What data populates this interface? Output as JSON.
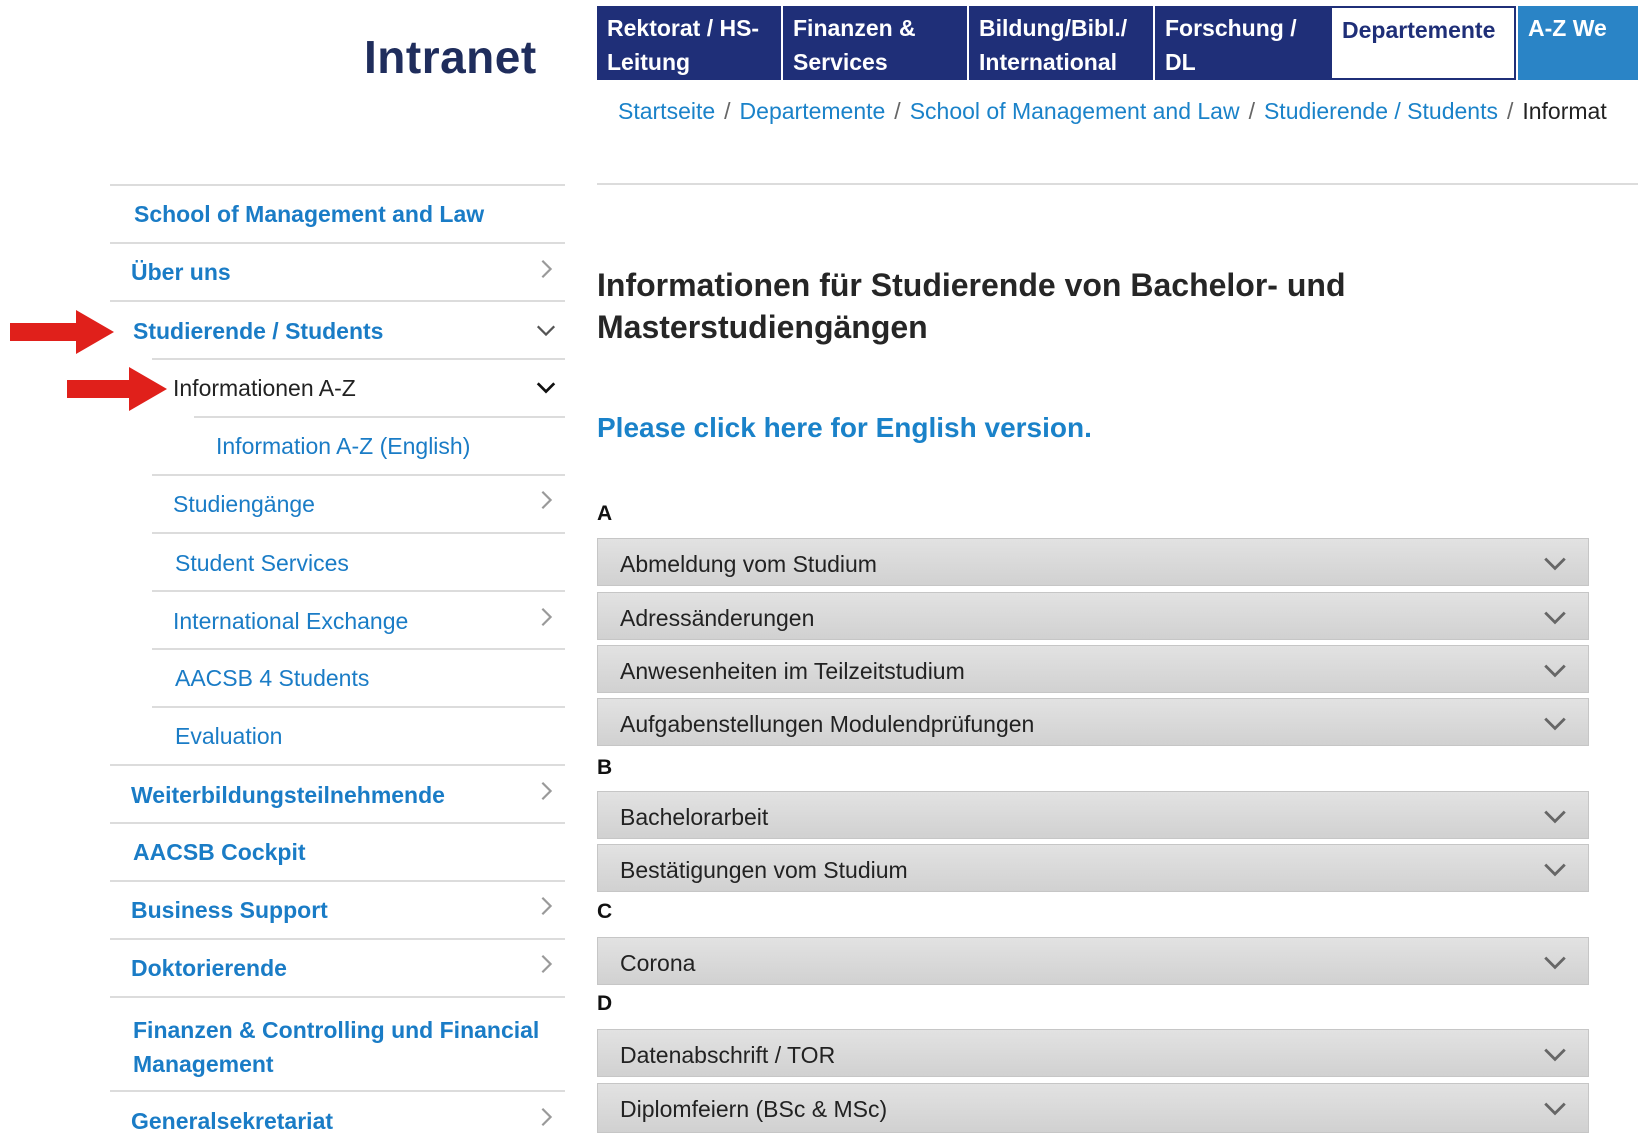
{
  "header": {
    "logo": "Intranet",
    "nav": [
      {
        "label": "Rektorat / HS-Leitung"
      },
      {
        "label": "Finanzen & Services"
      },
      {
        "label": "Bildung/Bibl./ International"
      },
      {
        "label": "Forschung / DL"
      },
      {
        "label": "Departemente",
        "active": true
      },
      {
        "label": "A-Z We"
      }
    ]
  },
  "breadcrumb": {
    "items": [
      "Startseite",
      "Departemente",
      "School of Management and Law",
      "Studierende / Students"
    ],
    "current": "Informat",
    "separator": "/"
  },
  "sidebar": {
    "title": "School of Management and Law",
    "items": [
      {
        "label": "Über uns"
      },
      {
        "label": "Studierende / Students"
      },
      {
        "label": "Informationen A-Z"
      },
      {
        "label": "Information A-Z (English)"
      },
      {
        "label": "Studiengänge"
      },
      {
        "label": "Student Services"
      },
      {
        "label": "International Exchange"
      },
      {
        "label": "AACSB 4 Students"
      },
      {
        "label": "Evaluation"
      },
      {
        "label": "Weiterbildungsteilnehmende"
      },
      {
        "label": "AACSB Cockpit"
      },
      {
        "label": "Business Support"
      },
      {
        "label": "Doktorierende"
      },
      {
        "label": "Finanzen & Controlling und Financial Management"
      },
      {
        "label": "Generalsekretariat"
      }
    ]
  },
  "main": {
    "headline": "Informationen für Studierende von Bachelor- und Masterstudiengängen",
    "english_link": "Please click here for English version.",
    "sections": [
      {
        "letter": "A",
        "items": [
          "Abmeldung vom Studium",
          "Adressänderungen",
          "Anwesenheiten im Teilzeitstudium",
          "Aufgabenstellungen Modulendprüfungen"
        ]
      },
      {
        "letter": "B",
        "items": [
          "Bachelorarbeit",
          "Bestätigungen vom Studium"
        ]
      },
      {
        "letter": "C",
        "items": [
          "Corona"
        ]
      },
      {
        "letter": "D",
        "items": [
          "Datenabschrift / TOR",
          "Diplomfeiern (BSc & MSc)"
        ]
      }
    ]
  },
  "colors": {
    "nav_bg": "#1f2f78",
    "az_tab_bg": "#2a84c6",
    "link": "#1a7cc6",
    "annotation_arrow": "#e0201b"
  },
  "icons": {
    "chevron_right": "chevron-right-icon",
    "chevron_down": "chevron-down-icon",
    "annotation_arrow": "red-arrow-icon"
  }
}
